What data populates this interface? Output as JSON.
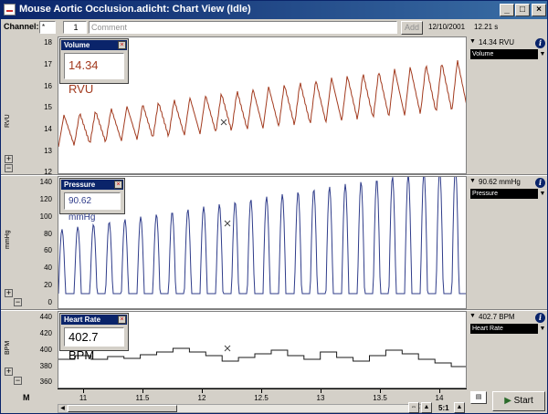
{
  "window": {
    "title": "Mouse Aortic Occlusion.adicht: Chart View (Idle)",
    "minimize": "_",
    "maximize": "□",
    "close": "×"
  },
  "toolbar": {
    "channel_label": "Channel:",
    "channel_select": "*",
    "comment_number": "1",
    "comment_placeholder": "Comment",
    "add_label": "Add",
    "date": "12/10/2001",
    "time_readout": "12.21 s"
  },
  "channels": [
    {
      "name": "Volume",
      "popup_value": "14.34 RVU",
      "side_value": "14.34 RVU",
      "side_select": "Volume",
      "unit": "RVU",
      "ticks": [
        "18",
        "17",
        "16",
        "15",
        "14",
        "13",
        "12"
      ],
      "color": "#a23a1e"
    },
    {
      "name": "Pressure",
      "popup_value": "90.62 mmHg",
      "side_value": "90.62 mmHg",
      "side_select": "Pressure",
      "unit": "mmHg",
      "ticks": [
        "140",
        "120",
        "100",
        "80",
        "60",
        "40",
        "20",
        "0"
      ],
      "color": "#2f3c8a"
    },
    {
      "name": "Heart Rate",
      "popup_value": "402.7 BPM",
      "side_value": "402.7 BPM",
      "side_select": "Heart Rate",
      "unit": "BPM",
      "ticks": [
        "440",
        "420",
        "400",
        "380",
        "360"
      ],
      "color": "#1a1a1a"
    }
  ],
  "time_axis": {
    "ticks": [
      "11",
      "11.5",
      "12",
      "12.5",
      "13",
      "13.5",
      "14"
    ]
  },
  "bottom": {
    "zoom_ratio": "5:1",
    "start_label": "Start"
  },
  "colors": {
    "titlebar": "#0a246a",
    "face": "#d4d0c8"
  }
}
